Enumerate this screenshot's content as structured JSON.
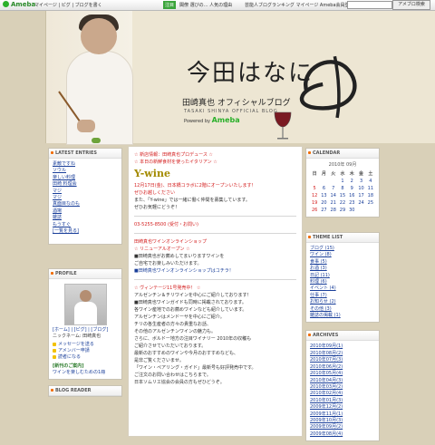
{
  "topbar": {
    "logo": "Ameba",
    "nav": "マイページ | ピグ | ブログを書く",
    "badge": "注目",
    "center": "閣僚 選びの… 人気の理由",
    "mid2": "芸能人ブログランキング マイページ Ameba会員登録",
    "search_btn": "アメブロ検索"
  },
  "header": {
    "title": "今田はなに",
    "blog_name": "田崎真也 オフィシャルブログ",
    "blog_sub": "TASAKI SHINYA OFFICIAL BLOG",
    "powered_prefix": "Powered by",
    "powered_brand": "Ameba"
  },
  "latest_entries": {
    "title": "LATEST ENTRIES",
    "items": [
      "素敵ですね",
      "ソウル",
      "楽しい料理",
      "田崎 料理会",
      "マジ",
      "マジ",
      "真面目なのも",
      "酒場",
      "雑誌",
      "もうすぐ",
      "[一覧を見る]"
    ]
  },
  "calendar": {
    "title": "CALENDAR",
    "month": "2010年 09月",
    "weekdays": [
      "日",
      "月",
      "火",
      "水",
      "木",
      "金",
      "土"
    ],
    "rows": [
      [
        "",
        "",
        "",
        "1",
        "2",
        "3",
        "4"
      ],
      [
        "5",
        "6",
        "7",
        "8",
        "9",
        "10",
        "11"
      ],
      [
        "12",
        "13",
        "14",
        "15",
        "16",
        "17",
        "18"
      ],
      [
        "19",
        "20",
        "21",
        "22",
        "23",
        "24",
        "25"
      ],
      [
        "26",
        "27",
        "28",
        "29",
        "30",
        "",
        ""
      ]
    ]
  },
  "theme_list": {
    "title": "THEME LIST",
    "items": [
      "ブログ (15)",
      "ワイン (8)",
      "食事 (5)",
      "お酒 (3)",
      "日記 (11)",
      "料理 (6)",
      "イベント (4)",
      "仕事 (7)",
      "お知らせ (2)",
      "その他 (3)",
      "雑誌の掲載 (1)"
    ]
  },
  "profile": {
    "title": "PROFILE",
    "links": [
      "[ホーム] | [ピグ] | [ブログ]",
      "ニックネーム: 田崎真也",
      "メッセージを送る",
      "アメンバー申請",
      "読者になる"
    ],
    "books_label": "[新刊のご案内]",
    "books_sub": "ワインを楽しむための1冊"
  },
  "archives": {
    "title": "ARCHIVES",
    "items": [
      "2010年09月(1)",
      "2010年08月(2)",
      "2010年07月(3)",
      "2010年06月(2)",
      "2010年05月(4)",
      "2010年04月(3)",
      "2010年03月(2)",
      "2010年02月(4)",
      "2010年01月(3)",
      "2009年12月(2)",
      "2009年11月(1)",
      "2009年10月(3)",
      "2009年09月(2)",
      "2009年08月(4)"
    ]
  },
  "blog_reader": {
    "title": "BLOG READER"
  },
  "post": {
    "lines": [
      {
        "text": "☆ 新店情報：田崎真也プロデュース ☆",
        "style": "red"
      },
      {
        "text": "☆ 本日の新鮮食材を使ったイタリアン ☆",
        "style": "red"
      },
      {
        "text": "Y-wine",
        "style": "logo"
      },
      {
        "text": "12月17日(金)、日本橋コラボに2階にオープンいたします！",
        "style": "red"
      },
      {
        "text": "ぜひお越しください",
        "style": "red"
      },
      {
        "text": "また、「Y-wine」では一緒に働く仲間を募集しています。",
        "style": "normal"
      },
      {
        "text": "ぜひお気軽にどうぞ！",
        "style": "normal"
      },
      {
        "text": "",
        "style": "sep"
      },
      {
        "text": "03-5255-8500 (受付・お問い)",
        "style": "red"
      },
      {
        "text": "",
        "style": "sep"
      },
      {
        "text": "田崎真也ワインオンラインショップ",
        "style": "red"
      },
      {
        "text": "☆ リニューアルオープン ☆",
        "style": "red"
      },
      {
        "text": "■田崎真也がお薦めしてまいりますワインを",
        "style": "normal"
      },
      {
        "text": "ご自宅でお楽しみいただけます。",
        "style": "normal"
      },
      {
        "text": "■田崎真也ワインオンラインショップはコチラ！",
        "style": "normal"
      },
      {
        "text": "",
        "style": "sep"
      },
      {
        "text": "☆ ヴィンテージ11号発売中！ ☆",
        "style": "red"
      },
      {
        "text": "アルゼンチン＆チリワインを中心にご紹介しております！",
        "style": "normal"
      },
      {
        "text": "■田崎真也ワインガイドも同時に掲載されております。",
        "style": "normal"
      },
      {
        "text": "各ワイン産地でのお薦めワインなども紹介しています。",
        "style": "normal"
      },
      {
        "text": "アルゼンチンはメンドーサを中心にご紹介。",
        "style": "normal"
      },
      {
        "text": "チリの各生産者の方々の貴重なお話、",
        "style": "normal"
      },
      {
        "text": "その他のアルゼンチンワインの魅力も。",
        "style": "normal"
      },
      {
        "text": "さらに、ボルドー地方の注目ワイナリー 2010年の収穫も",
        "style": "normal"
      },
      {
        "text": "ご紹介させていただいております。",
        "style": "normal"
      },
      {
        "text": "最新のおすすめのワインや今月のおすすめなども、",
        "style": "normal"
      },
      {
        "text": "是非ご覧くださいませ。",
        "style": "normal"
      },
      {
        "text": "「ワイン・ペアリング・ガイド」最新号も好評発売中です。",
        "style": "normal"
      },
      {
        "text": "ご注文のお問い合わせはこちらまで。",
        "style": "normal"
      },
      {
        "text": "日本ソムリエ協会の会員の方もぜひどうぞ。",
        "style": "normal"
      }
    ]
  }
}
